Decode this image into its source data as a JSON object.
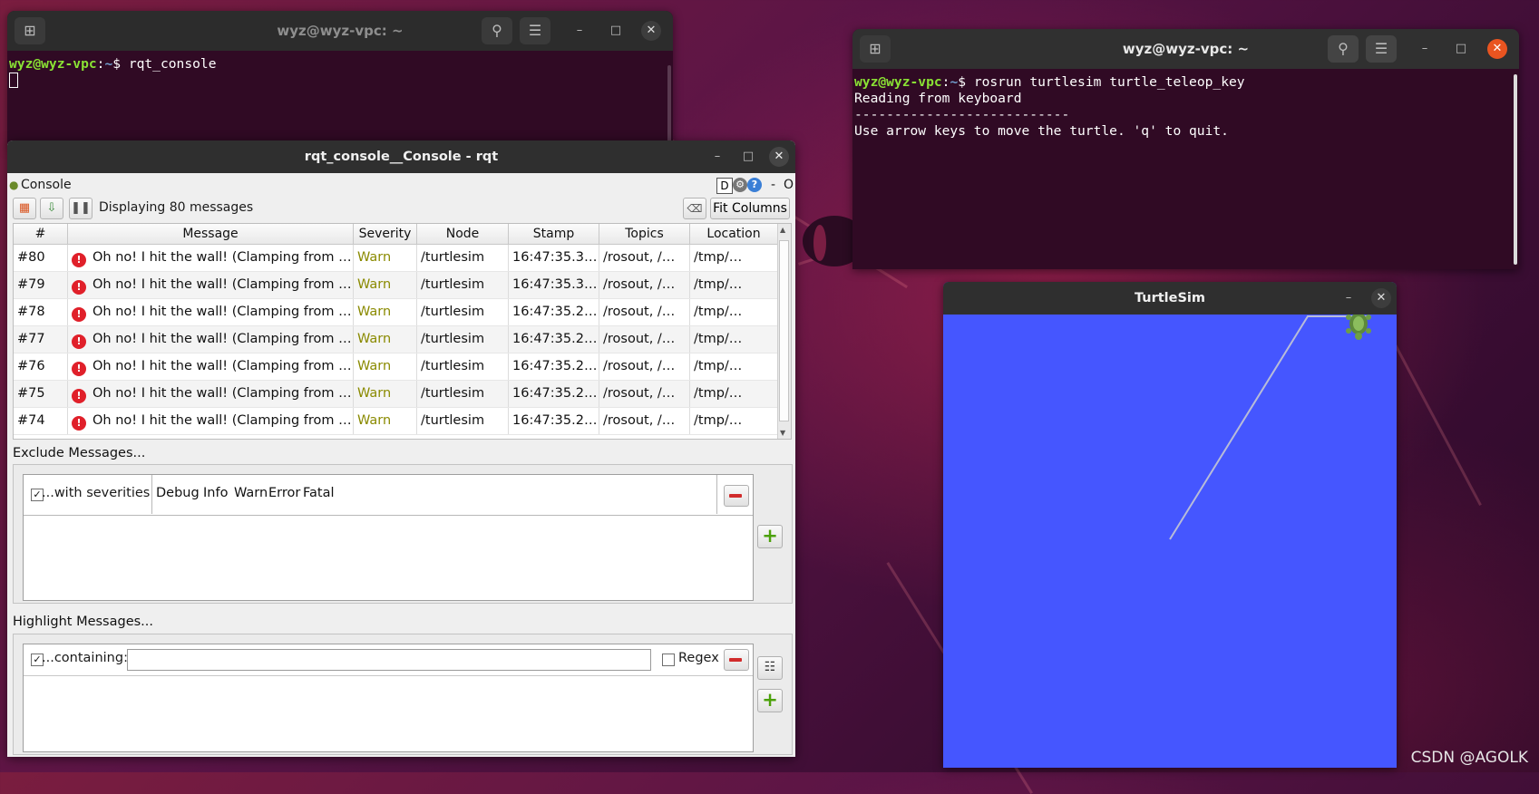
{
  "desktop": {
    "watermark": "CSDN @AGOLK"
  },
  "terminal1": {
    "title": "wyz@wyz-vpc: ~",
    "prompt_user": "wyz@wyz-vpc",
    "prompt_colon": ":",
    "prompt_dir": "~",
    "prompt_symbol": "$ ",
    "command": "rqt_console"
  },
  "terminal2": {
    "title": "wyz@wyz-vpc: ~",
    "prompt_user": "wyz@wyz-vpc",
    "prompt_colon": ":",
    "prompt_dir": "~",
    "prompt_symbol": "$ ",
    "command": "rosrun turtlesim turtle_teleop_key",
    "output": [
      "Reading from keyboard",
      "---------------------------",
      "Use arrow keys to move the turtle. 'q' to quit."
    ]
  },
  "rqt": {
    "title": "rqt_console__Console - rqt",
    "plugin_label": "Console",
    "plugin_controls": [
      "D",
      "⚙",
      "?",
      "-",
      "O"
    ],
    "status": "Displaying 80 messages",
    "fit_columns": "Fit Columns",
    "columns": [
      "#",
      "Message",
      "Severity",
      "Node",
      "Stamp",
      "Topics",
      "Location"
    ],
    "rows": [
      {
        "num": "#80",
        "message": "Oh no! I hit the wall! (Clamping from …",
        "severity": "Warn",
        "node": "/turtlesim",
        "stamp": "16:47:35.3…",
        "topics": "/rosout, /…",
        "location": "/tmp/…"
      },
      {
        "num": "#79",
        "message": "Oh no! I hit the wall! (Clamping from …",
        "severity": "Warn",
        "node": "/turtlesim",
        "stamp": "16:47:35.3…",
        "topics": "/rosout, /…",
        "location": "/tmp/…"
      },
      {
        "num": "#78",
        "message": "Oh no! I hit the wall! (Clamping from …",
        "severity": "Warn",
        "node": "/turtlesim",
        "stamp": "16:47:35.2…",
        "topics": "/rosout, /…",
        "location": "/tmp/…"
      },
      {
        "num": "#77",
        "message": "Oh no! I hit the wall! (Clamping from …",
        "severity": "Warn",
        "node": "/turtlesim",
        "stamp": "16:47:35.2…",
        "topics": "/rosout, /…",
        "location": "/tmp/…"
      },
      {
        "num": "#76",
        "message": "Oh no! I hit the wall! (Clamping from …",
        "severity": "Warn",
        "node": "/turtlesim",
        "stamp": "16:47:35.2…",
        "topics": "/rosout, /…",
        "location": "/tmp/…"
      },
      {
        "num": "#75",
        "message": "Oh no! I hit the wall! (Clamping from …",
        "severity": "Warn",
        "node": "/turtlesim",
        "stamp": "16:47:35.2…",
        "topics": "/rosout, /…",
        "location": "/tmp/…"
      },
      {
        "num": "#74",
        "message": "Oh no! I hit the wall! (Clamping from …",
        "severity": "Warn",
        "node": "/turtlesim",
        "stamp": "16:47:35.2…",
        "topics": "/rosout, /…",
        "location": "/tmp/…"
      }
    ],
    "exclude": {
      "header": "Exclude Messages...",
      "filter_label": "...with severities:",
      "severities": [
        "Debug",
        "Info",
        "Warn",
        "Error",
        "Fatal"
      ]
    },
    "highlight": {
      "header": "Highlight Messages...",
      "filter_label": "...containing:",
      "value": "",
      "regex_label": "Regex"
    }
  },
  "turtlesim": {
    "title": "TurtleSim",
    "background": "#4556ff"
  },
  "colors": {
    "terminal_bg": "#300a24",
    "prompt_user": "#8ae234",
    "prompt_dir": "#729fcf",
    "close_active": "#e95420",
    "warn": "#8a8a00"
  }
}
